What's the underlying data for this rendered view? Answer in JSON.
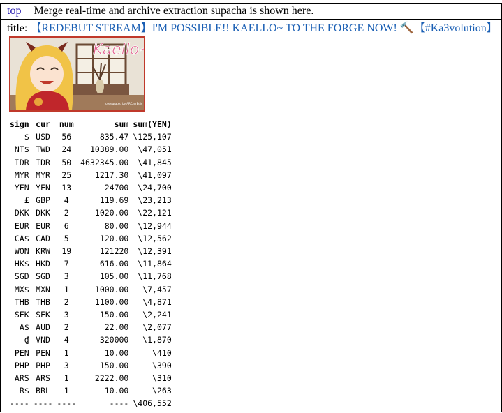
{
  "header": {
    "top_link": "top",
    "message": "Merge real-time and archive extraction supacha is shown here."
  },
  "stream": {
    "title_label": "title:",
    "title": "【REDEBUT STREAM】I'M POSSIBLE!! KAELLO~ TO THE FORGE NOW! 🔨【#Ka3volution】",
    "thumbnail_text": "Kaello~",
    "thumbnail_caption": "codegrated by ARCzerEdis"
  },
  "table": {
    "columns": [
      "sign",
      "cur",
      "num",
      "sum",
      "sum(YEN)"
    ],
    "rows": [
      [
        "$",
        "USD",
        "56",
        "835.47",
        "\\125,107"
      ],
      [
        "NT$",
        "TWD",
        "24",
        "10389.00",
        "\\47,051"
      ],
      [
        "IDR",
        "IDR",
        "50",
        "4632345.00",
        "\\41,845"
      ],
      [
        "MYR",
        "MYR",
        "25",
        "1217.30",
        "\\41,097"
      ],
      [
        "YEN",
        "YEN",
        "13",
        "24700",
        "\\24,700"
      ],
      [
        "£",
        "GBP",
        "4",
        "119.69",
        "\\23,213"
      ],
      [
        "DKK",
        "DKK",
        "2",
        "1020.00",
        "\\22,121"
      ],
      [
        "EUR",
        "EUR",
        "6",
        "80.00",
        "\\12,944"
      ],
      [
        "CA$",
        "CAD",
        "5",
        "120.00",
        "\\12,562"
      ],
      [
        "WON",
        "KRW",
        "19",
        "121220",
        "\\12,391"
      ],
      [
        "HK$",
        "HKD",
        "7",
        "616.00",
        "\\11,864"
      ],
      [
        "SGD",
        "SGD",
        "3",
        "105.00",
        "\\11,768"
      ],
      [
        "MX$",
        "MXN",
        "1",
        "1000.00",
        "\\7,457"
      ],
      [
        "THB",
        "THB",
        "2",
        "1100.00",
        "\\4,871"
      ],
      [
        "SEK",
        "SEK",
        "3",
        "150.00",
        "\\2,241"
      ],
      [
        "A$",
        "AUD",
        "2",
        "22.00",
        "\\2,077"
      ],
      [
        "₫",
        "VND",
        "4",
        "320000",
        "\\1,870"
      ],
      [
        "PEN",
        "PEN",
        "1",
        "10.00",
        "\\410"
      ],
      [
        "PHP",
        "PHP",
        "3",
        "150.00",
        "\\390"
      ],
      [
        "ARS",
        "ARS",
        "1",
        "2222.00",
        "\\310"
      ],
      [
        "R$",
        "BRL",
        "1",
        "10.00",
        "\\263"
      ]
    ],
    "footer": [
      "----",
      "----",
      "----",
      "----",
      "\\406,552"
    ]
  }
}
